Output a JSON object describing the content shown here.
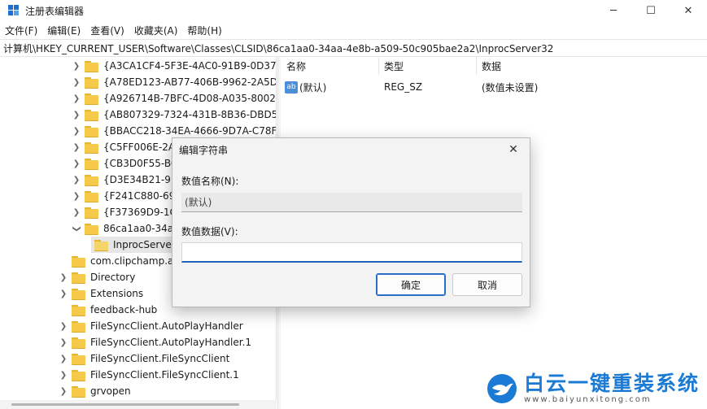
{
  "window": {
    "title": "注册表编辑器",
    "controls": {
      "minimize": "─",
      "maximize": "☐",
      "close": "✕"
    }
  },
  "menu": [
    "文件(F)",
    "编辑(E)",
    "查看(V)",
    "收藏夹(A)",
    "帮助(H)"
  ],
  "address": "计算机\\HKEY_CURRENT_USER\\Software\\Classes\\CLSID\\86ca1aa0-34aa-4e8b-a509-50c905bae2a2\\InprocServer32",
  "tree": {
    "clsid_items": [
      "{A3CA1CF4-5F3E-4AC0-91B9-0D37",
      "{A78ED123-AB77-406B-9962-2A5D",
      "{A926714B-7BFC-4D08-A035-80021",
      "{AB807329-7324-431B-8B36-DBD5",
      "{BBACC218-34EA-4666-9D7A-C78F",
      "{C5FF006E-2AE",
      "{CB3D0F55-BC2",
      "{D3E34B21-9D7",
      "{F241C880-698",
      "{F37369D9-1C2",
      "86ca1aa0-34aa"
    ],
    "child": "InprocServer32",
    "root_items": [
      "com.clipchamp.ap",
      "Directory",
      "Extensions",
      "feedback-hub",
      "FileSyncClient.AutoPlayHandler",
      "FileSyncClient.AutoPlayHandler.1",
      "FileSyncClient.FileSyncClient",
      "FileSyncClient.FileSyncClient.1",
      "grvopen"
    ]
  },
  "list": {
    "columns": [
      "名称",
      "类型",
      "数据"
    ],
    "rows": [
      {
        "icon": "ab",
        "name": "(默认)",
        "type": "REG_SZ",
        "data": "(数值未设置)"
      }
    ]
  },
  "dialog": {
    "title": "编辑字符串",
    "close": "✕",
    "name_label": "数值名称(N):",
    "name_value": "(默认)",
    "data_label": "数值数据(V):",
    "data_value": "",
    "ok": "确定",
    "cancel": "取消"
  },
  "watermark": {
    "main": "白云一键重装系统",
    "sub": "www.baiyunxitong.com",
    "color": "#1b7bd4"
  },
  "colors": {
    "folder": "#f7c94a",
    "accent": "#1e63b8"
  }
}
